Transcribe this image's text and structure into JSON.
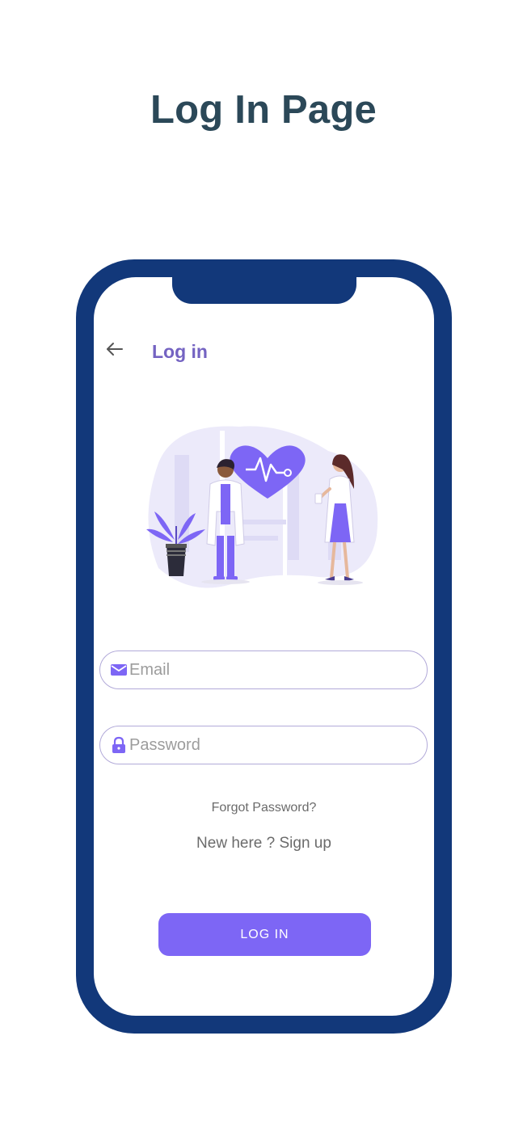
{
  "page": {
    "heading": "Log In Page"
  },
  "app_bar": {
    "back_icon": "arrow-left-icon",
    "title": "Log in"
  },
  "illustration": {
    "name": "doctors-heart-illustration"
  },
  "email": {
    "placeholder": "Email",
    "value": "",
    "icon": "mail-icon"
  },
  "password": {
    "placeholder": "Password",
    "value": "",
    "icon": "lock-icon"
  },
  "links": {
    "forgot_password": "Forgot Password?",
    "signup": "New here ? Sign up"
  },
  "button": {
    "login_label": "LOG IN"
  },
  "colors": {
    "frame": "#12387a",
    "accent": "#7d66f5",
    "title_text": "#7463c2",
    "heading_text": "#2b4858",
    "field_border": "#b2aad9"
  }
}
